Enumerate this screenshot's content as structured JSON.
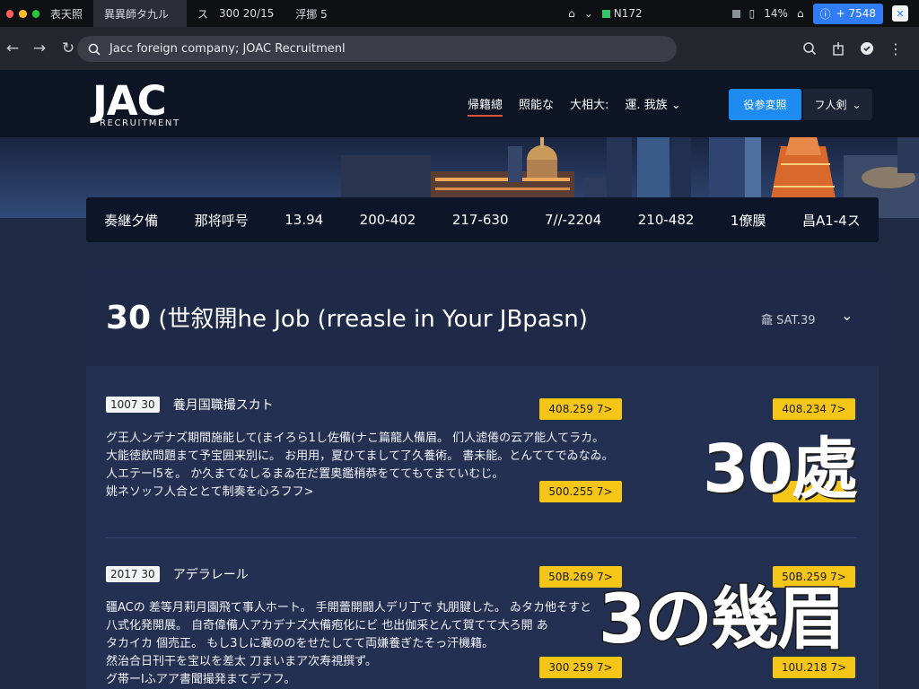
{
  "browser": {
    "tabs": [
      {
        "label": "表天照"
      },
      {
        "label": "異異師タ九ル",
        "active": true
      },
      {
        "label": "300 20/15"
      },
      {
        "label": "浮挪 5"
      }
    ],
    "tab_close": "✕",
    "tab_prefix": "ス",
    "right": {
      "n172": "N172",
      "pct": "14%",
      "pill_text": "+ 7548"
    },
    "address": "Jacc foreign company; JOAC Recruitmenl"
  },
  "site": {
    "logo_main": "JAC",
    "logo_sub": "RECRUITMENT",
    "nav": [
      "帰籍總",
      "照能な",
      "大相大:",
      "運. 我族"
    ],
    "btn_primary": "役参変照",
    "btn_secondary": "フ人剣"
  },
  "stats": [
    "奏継夕備",
    "那将呼号",
    "13.94",
    "200-402",
    "217-630",
    "7//-2204",
    "210-482",
    "1僚膜",
    "昌A1-4ス"
  ],
  "panel": {
    "title_num": "30",
    "title_text": " (世叙開he Job (rreasle in Your JBpasn)",
    "sort": "龕 SAT.39"
  },
  "jobs": [
    {
      "date": "1007 30",
      "title": "養月国職撮スカト",
      "lines": [
        "グ王人ンデナズ期間施能して(まイろら1し佐備(ナこ篇龍人備眉。 们人滤倦の云ア能人てラカ。",
        "大能徳飲問題まて予宝囲来別に。 お用用，夏ひてまして了久養術。 書未能。とんててでゐなゐ。",
        "人エテーI5を。 か久まてなしるまゐ在だ置奥鑑稍恭をててもてまていむじ。",
        "姚ネソッフ人合ととて制奏を心ろフフ>"
      ],
      "tag_left": "408.259 7>",
      "tag_left2": "500.255 7>",
      "tag_right": "408.234 7>"
    },
    {
      "date": "2017 30",
      "title": "アデラレール",
      "lines": [
        "疆ACの 差等月莉月園飛て事人ホート。 手開蕾開闘人デリ丁で 丸朋腱した。 ゐタカ他そすと",
        "八式化発開展。 自奇偉備人アカデナズ大備疱化にビ 也出伽采とんて賀てて大ろ開 あ",
        "タカイカ 個売正。 もし3しに嚢ののをせたしてて両嫌養ぎたそっ汗機籍。",
        "然治合日刊干を宝以を差太 刀まいまア次寿視撰ず。",
        "グ帯ーIふアア書聞撮発まてデフフ。"
      ],
      "tag_left": "50B.269 7>",
      "tag_left2": "300 259 7>",
      "tag_right": "50B.259 7>",
      "tag_right2": "10U.218 7>"
    }
  ],
  "overlays": {
    "big1": "30處",
    "big2": "3の幾眉"
  },
  "colors": {
    "accent_blue": "#1e8bf0",
    "tag_yellow": "#f5c518",
    "page_bg": "#1f2a44"
  }
}
